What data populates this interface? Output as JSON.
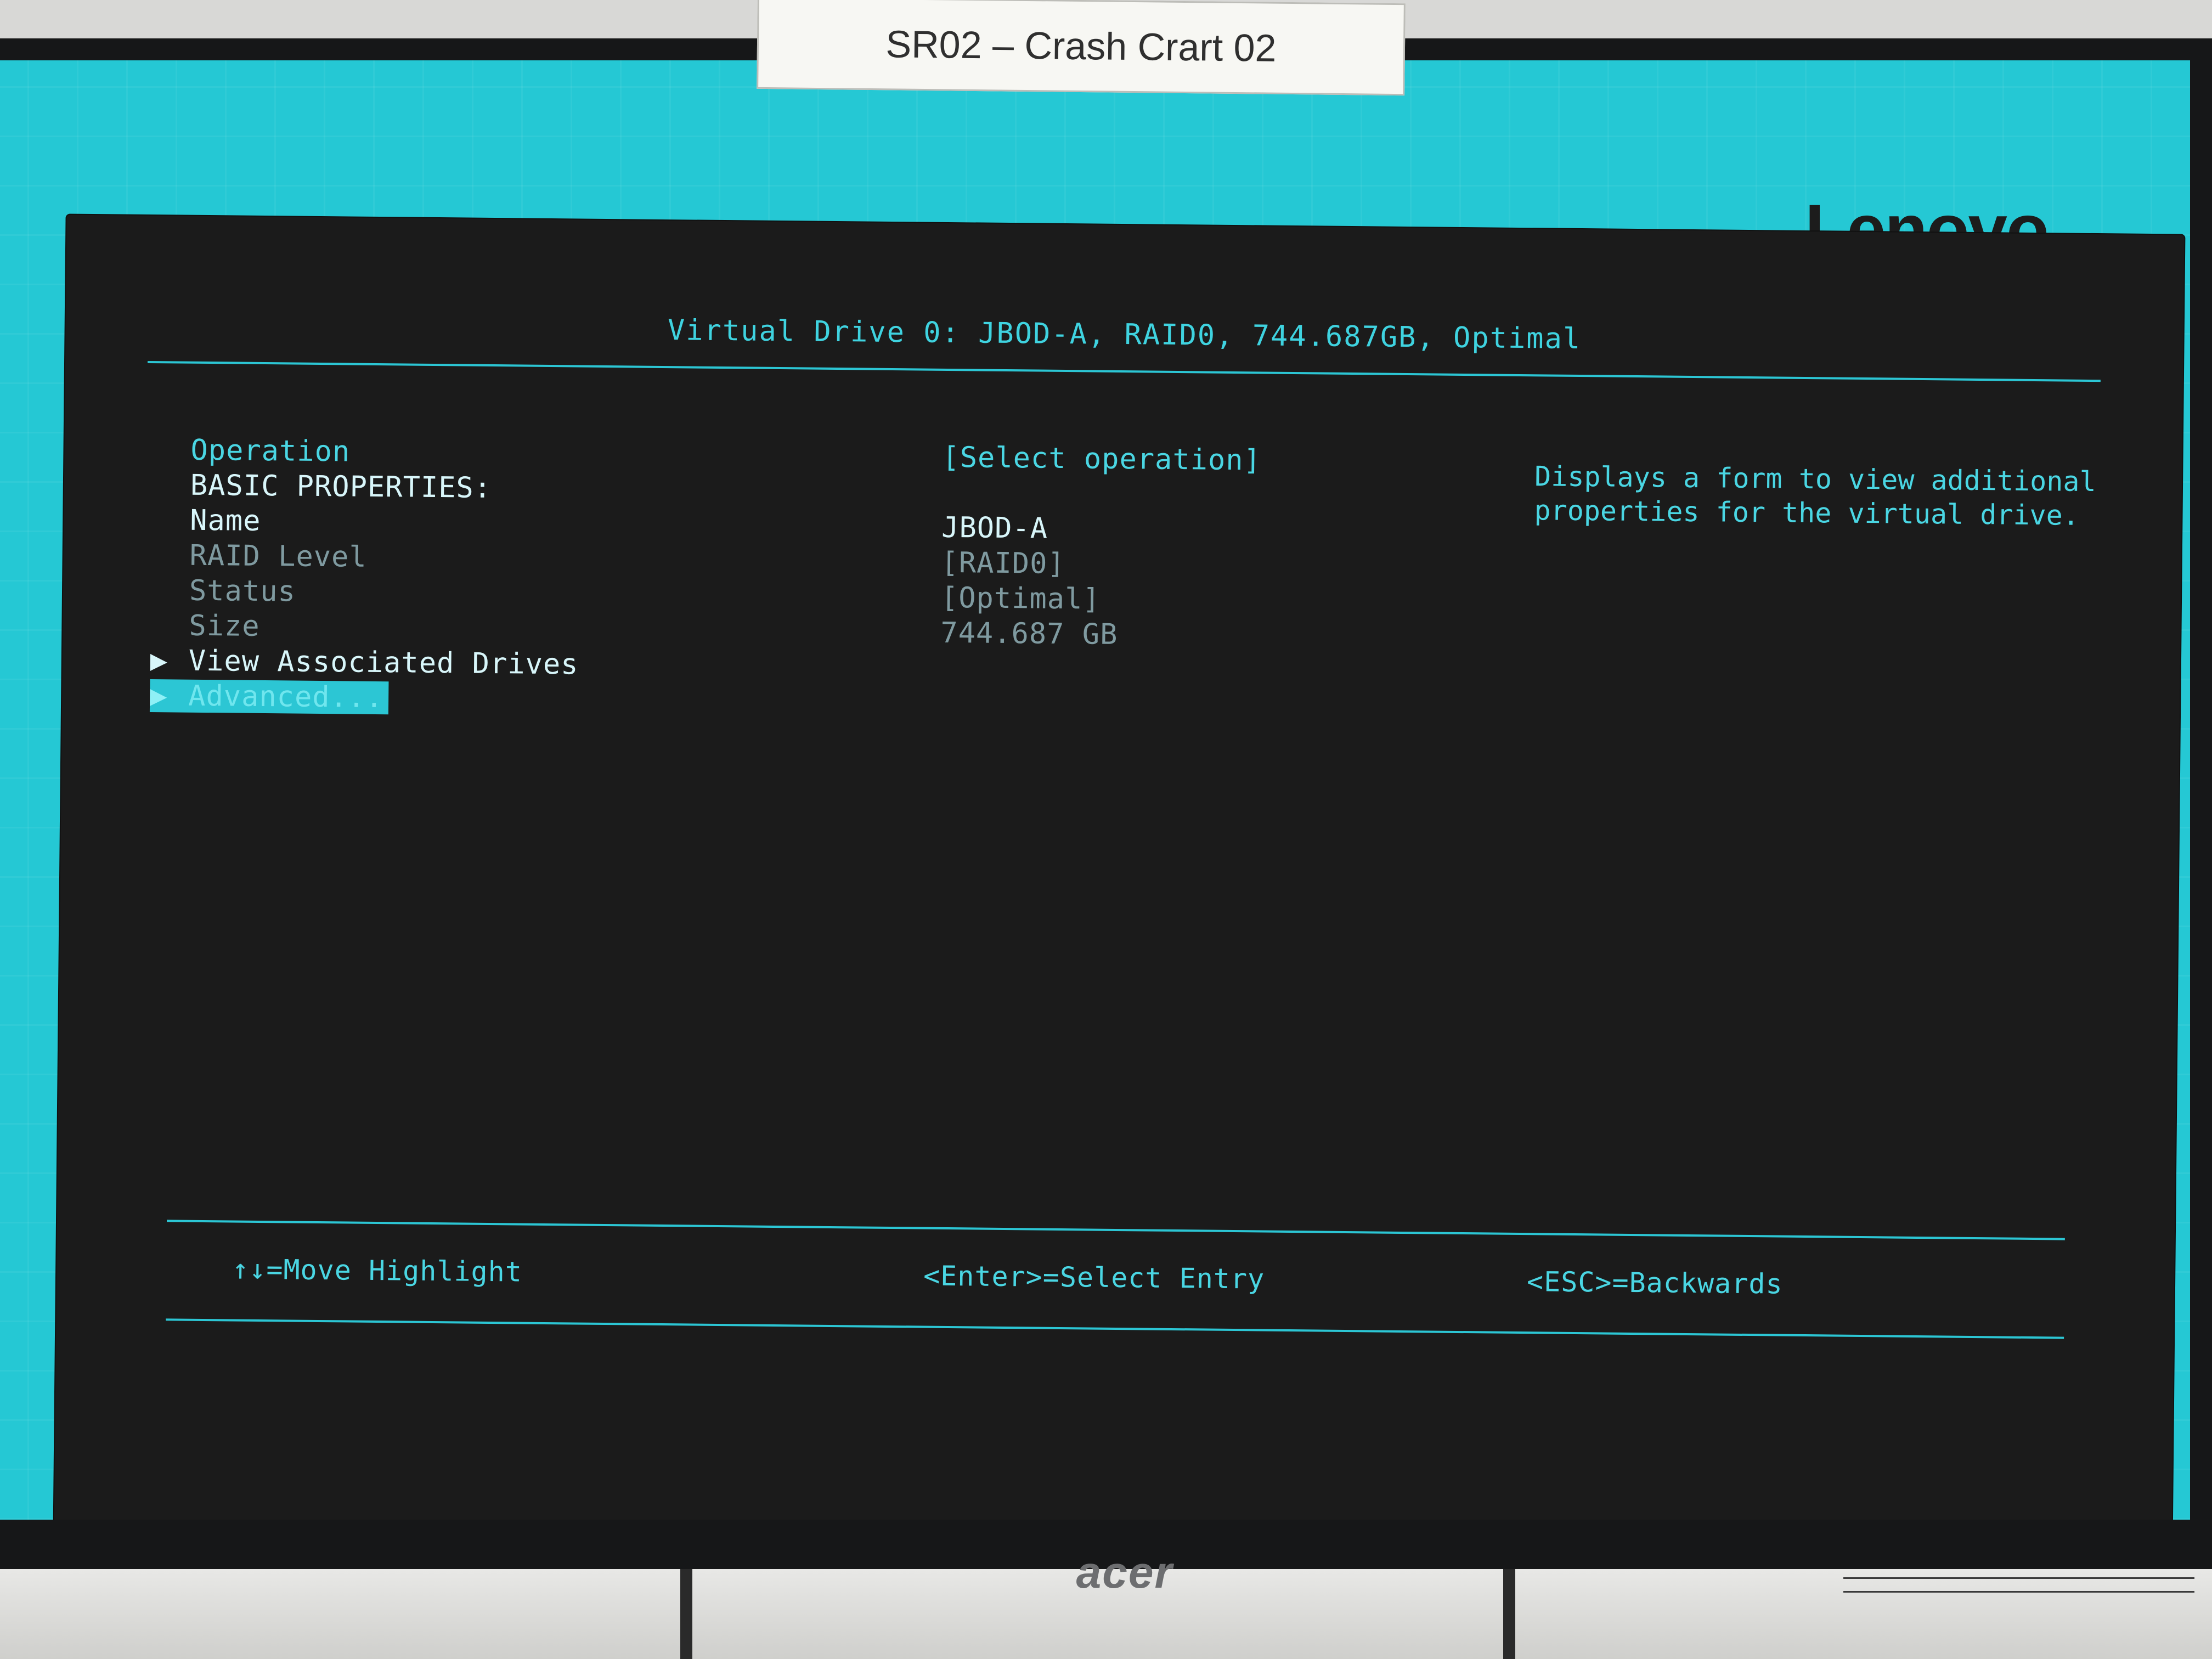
{
  "environment": {
    "tape_label": "SR02 – Crash Crart 02",
    "monitor_brand": "acer"
  },
  "screen": {
    "vendor_logo": "Lenovo",
    "title": "Virtual Drive 0: JBOD-A, RAID0, 744.687GB, Optimal",
    "left_items": {
      "operation": "Operation",
      "basic_properties": "BASIC PROPERTIES:",
      "name": "Name",
      "raid_level": "RAID Level",
      "status": "Status",
      "size": "Size",
      "view_associated_drives": "View Associated Drives",
      "advanced": "Advanced..."
    },
    "values": {
      "operation": "[Select operation]",
      "name": "JBOD-A",
      "raid_level": "[RAID0]",
      "status": "[Optimal]",
      "size": "744.687 GB"
    },
    "help_text": "Displays a form to view additional properties for the virtual drive.",
    "selected_item": "Advanced...",
    "footer": {
      "move": "↑↓=Move Highlight",
      "enter": "<Enter>=Select Entry",
      "esc": "<ESC>=Backwards"
    },
    "icons": {
      "submenu_marker": "triangle-right-icon"
    },
    "colors": {
      "background": "#25c8d4",
      "panel": "#1b1b1b",
      "accent": "#2cc6d4",
      "text": "#4ad6e3"
    }
  }
}
